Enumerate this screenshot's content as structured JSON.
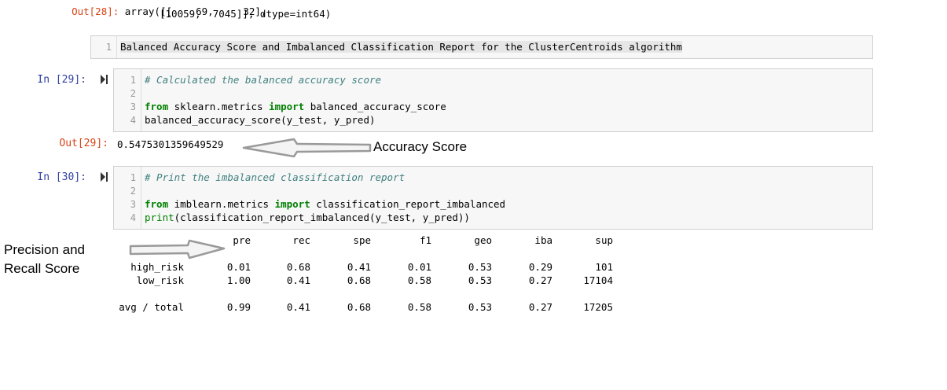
{
  "prev_output": {
    "line1": "Out[28]: array([[    69,     32],",
    "line2": "[10059,  7045]], dtype=int64)"
  },
  "markdown_cell": {
    "line_number": "1",
    "text": "Balanced Accuracy Score and Imbalanced Classification Report for the ClusterCentroids algorithm"
  },
  "cell29": {
    "prompt": "In [29]:",
    "lines": [
      {
        "num": "1",
        "comment": "# Calculated the balanced accuracy score"
      },
      {
        "num": "2"
      },
      {
        "num": "3",
        "kw1": "from",
        "mod": " sklearn.metrics ",
        "kw2": "import",
        "name": " balanced_accuracy_score"
      },
      {
        "num": "4",
        "text": "balanced_accuracy_score(y_test, y_pred)"
      }
    ],
    "out_prompt": "Out[29]:",
    "output": "0.5475301359649529"
  },
  "annotation_accuracy": "Accuracy Score",
  "cell30": {
    "prompt": "In [30]:",
    "lines": [
      {
        "num": "1",
        "comment": "# Print the imbalanced classification report"
      },
      {
        "num": "2"
      },
      {
        "num": "3",
        "kw1": "from",
        "mod": " imblearn.metrics ",
        "kw2": "import",
        "name": " classification_report_imbalanced"
      },
      {
        "num": "4",
        "fn": "print",
        "text": "(classification_report_imbalanced(y_test, y_pred))"
      }
    ]
  },
  "annotation_precision": {
    "line1": "Precision and",
    "line2": "Recall Score"
  },
  "report": {
    "headers": [
      "pre",
      "rec",
      "spe",
      "f1",
      "geo",
      "iba",
      "sup"
    ],
    "rows": [
      {
        "label": "high_risk",
        "values": [
          "0.01",
          "0.68",
          "0.41",
          "0.01",
          "0.53",
          "0.29",
          "101"
        ]
      },
      {
        "label": "low_risk",
        "values": [
          "1.00",
          "0.41",
          "0.68",
          "0.58",
          "0.53",
          "0.27",
          "17104"
        ]
      },
      {
        "label": "avg / total",
        "values": [
          "0.99",
          "0.41",
          "0.68",
          "0.58",
          "0.53",
          "0.27",
          "17205"
        ]
      }
    ]
  },
  "colors": {
    "prompt_in": "#303f9f",
    "prompt_out": "#d84315",
    "comment": "#408080",
    "keyword": "#008000",
    "cell_bg": "#f7f7f7"
  }
}
